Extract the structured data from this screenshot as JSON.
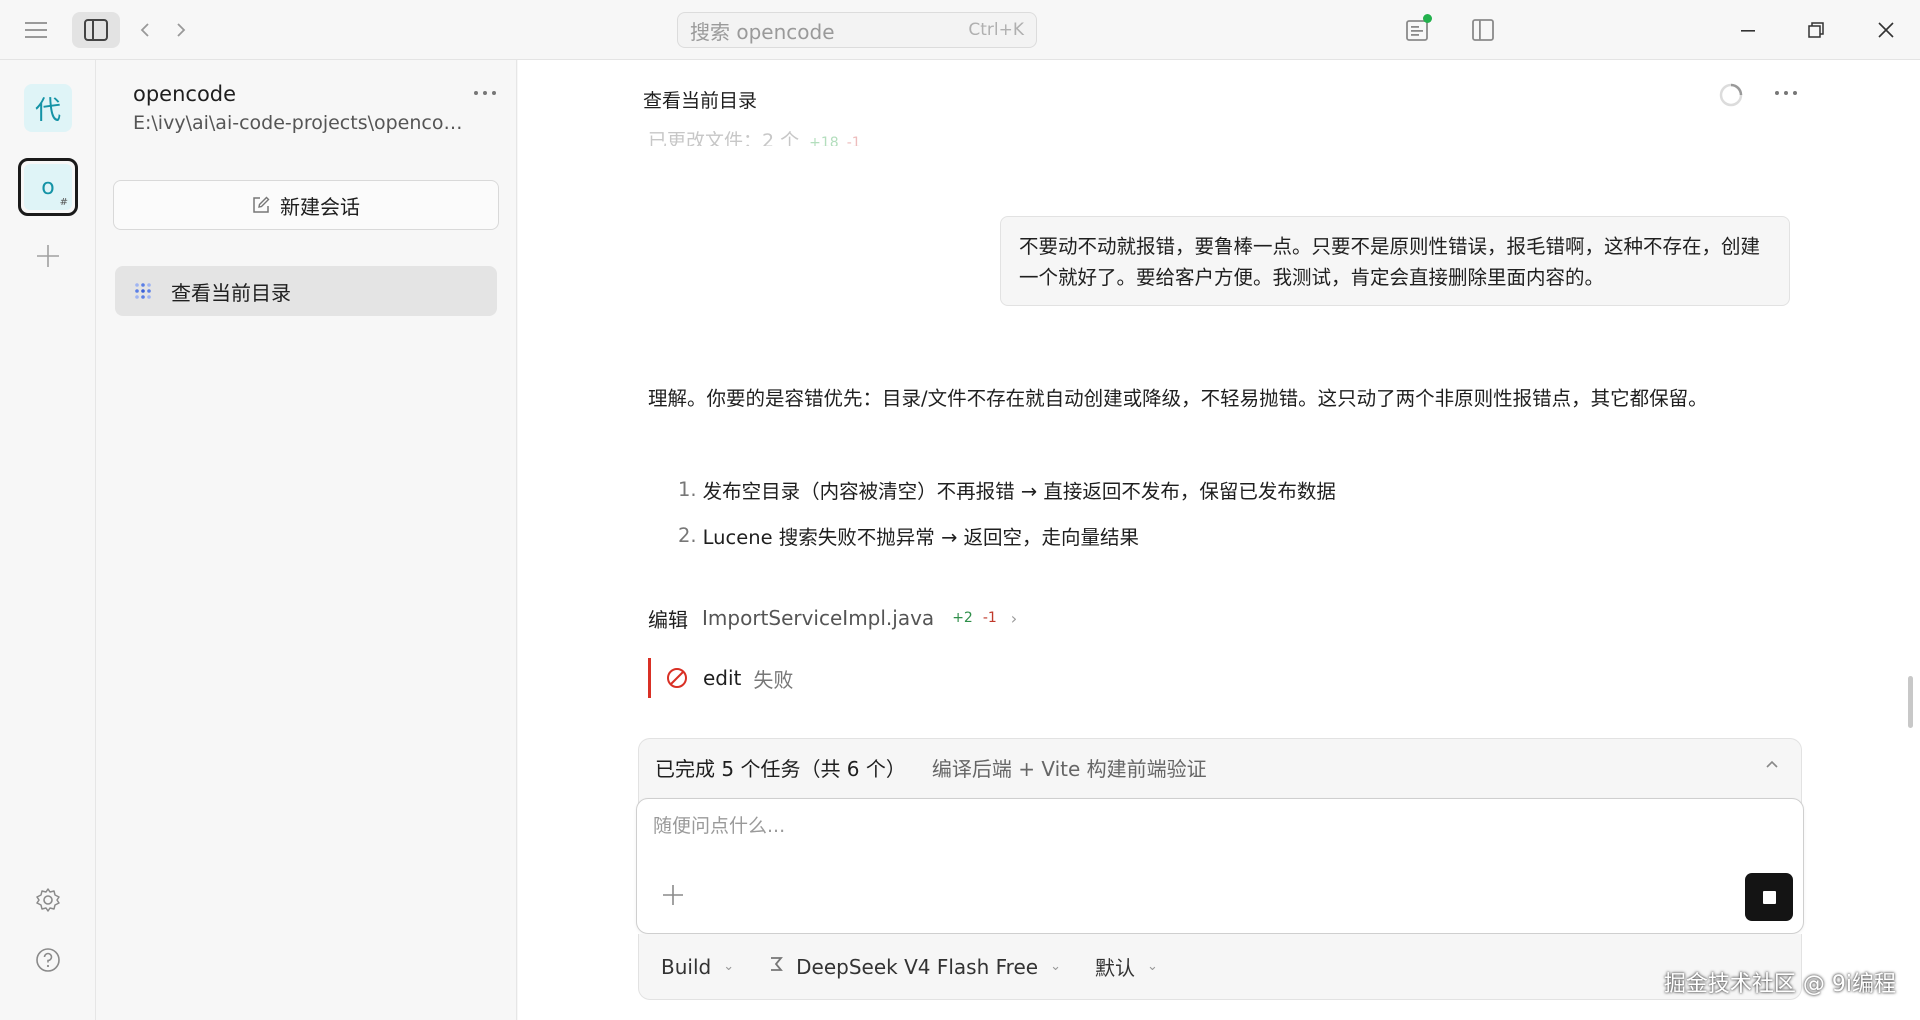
{
  "titlebar": {
    "search_placeholder": "搜索 opencode",
    "search_shortcut": "Ctrl+K"
  },
  "rail": {
    "avatar_text": "代",
    "project_text": "o",
    "project_sub": "#"
  },
  "sessions": {
    "project_name": "opencode",
    "project_path": "E:\\ivy\\ai\\ai-code-projects\\opencode",
    "new_session_label": "新建会话",
    "items": [
      {
        "label": "查看当前目录"
      }
    ]
  },
  "main": {
    "title": "查看当前目录",
    "faded_line": {
      "text": "已更改文件：2 个",
      "additions": "+18",
      "deletions": "-1"
    },
    "user_message": "不要动不动就报错，要鲁棒一点。只要不是原则性错误，报毛错啊，这种不存在，创建一个就好了。要给客户方便。我测试，肯定会直接删除里面内容的。",
    "answer_intro": "理解。你要的是容错优先：目录/文件不存在就自动创建或降级，不轻易抛错。这只动了两个非原则性报错点，其它都保留。",
    "steps": [
      {
        "num": "1.",
        "text": "发布空目录（内容被清空）不再报错 → 直接返回不发布，保留已发布数据"
      },
      {
        "num": "2.",
        "text": "Lucene 搜索失败不抛异常 → 返回空，走向量结果"
      }
    ],
    "edit": {
      "verb": "编辑",
      "file": "ImportServiceImpl.java",
      "additions": "+2",
      "deletions": "-1"
    },
    "tool_fail": {
      "tool": "edit",
      "status": "失败"
    }
  },
  "tasks": {
    "summary": "已完成 5 个任务（共 6 个）",
    "current": "编译后端 + Vite 构建前端验证"
  },
  "composer": {
    "placeholder": "随便问点什么...",
    "agent": "Build",
    "model": "DeepSeek V4 Flash Free",
    "variant": "默认"
  },
  "watermark": "掘金技术社区 @ 9i编程",
  "colors": {
    "accent_teal": "#1493a6",
    "success": "#23b14d",
    "error": "#d93025"
  }
}
